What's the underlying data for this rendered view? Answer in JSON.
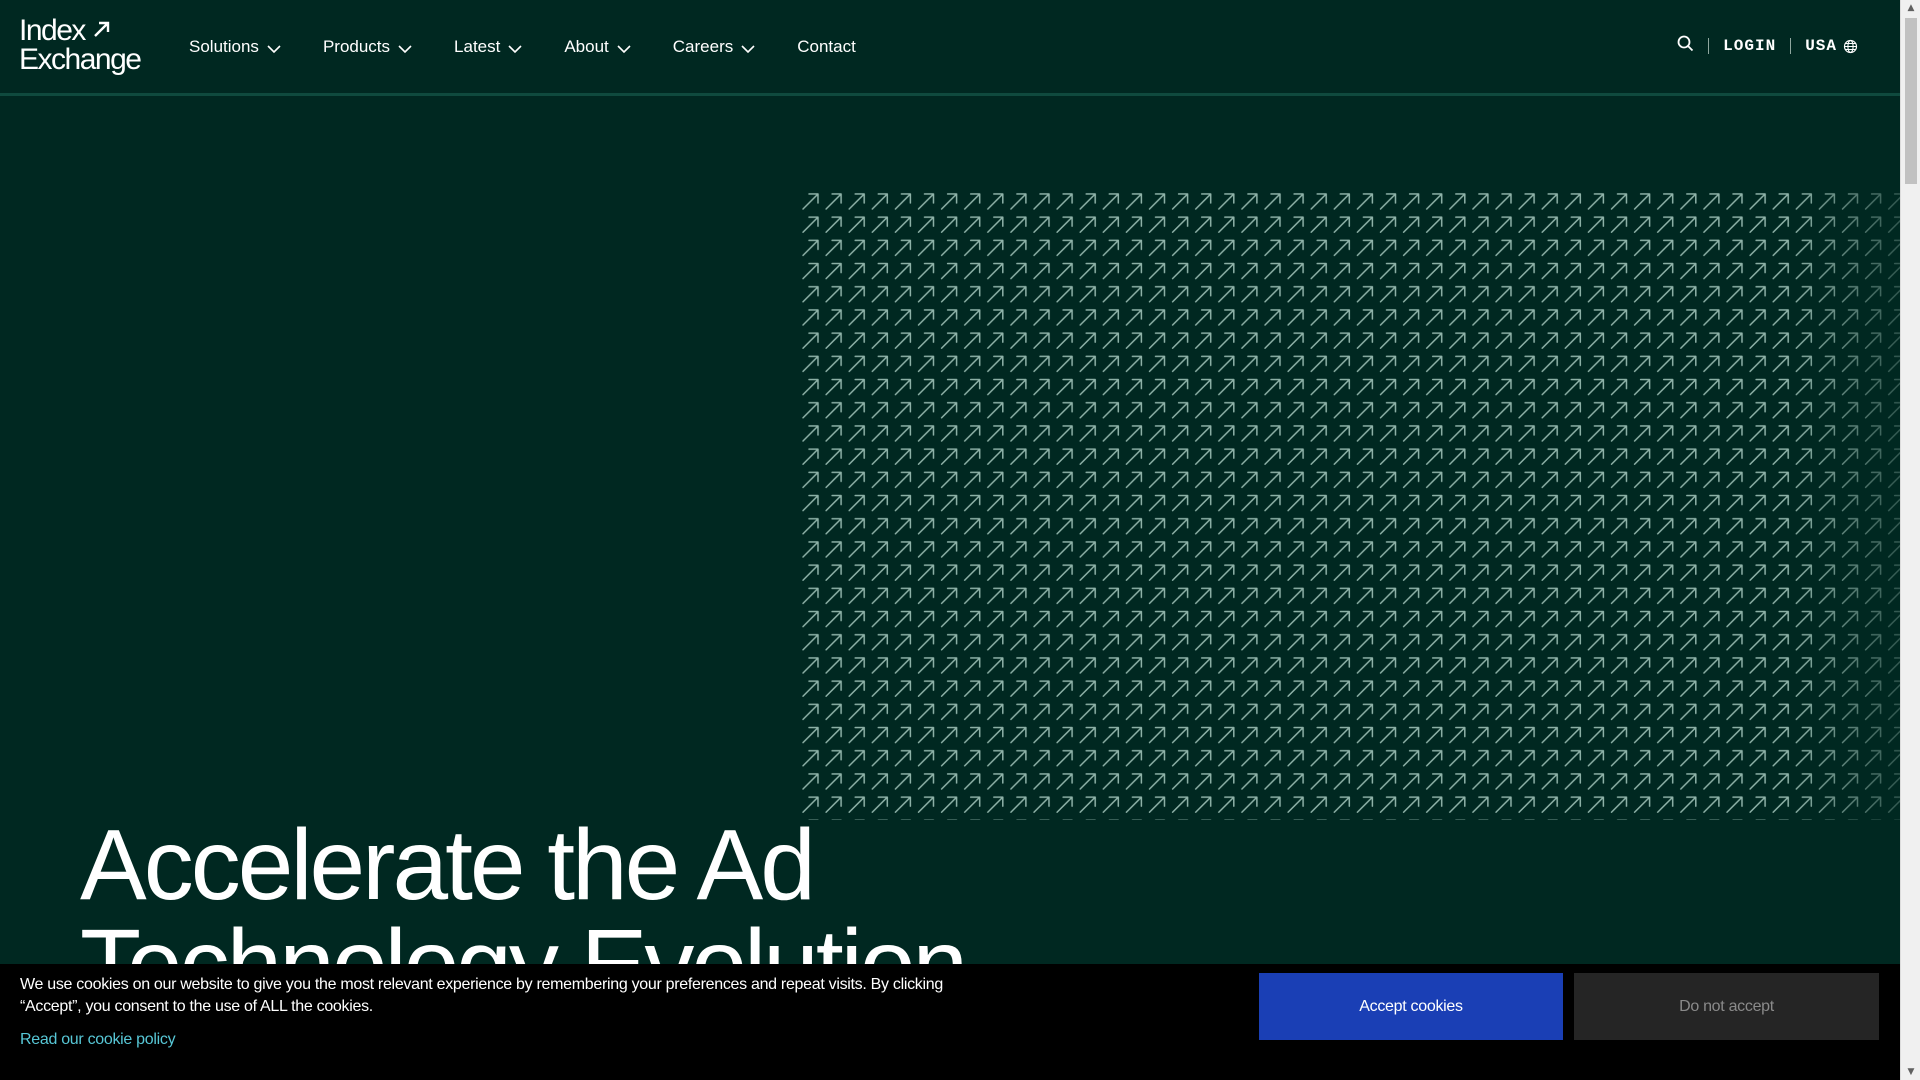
{
  "brand": {
    "logo_line1": "Index",
    "logo_line2": "Exchange"
  },
  "nav": {
    "items": [
      {
        "label": "Solutions",
        "has_dropdown": true
      },
      {
        "label": "Products",
        "has_dropdown": true
      },
      {
        "label": "Latest",
        "has_dropdown": true
      },
      {
        "label": "About",
        "has_dropdown": true
      },
      {
        "label": "Careers",
        "has_dropdown": true
      },
      {
        "label": "Contact",
        "has_dropdown": false
      }
    ]
  },
  "utility": {
    "search_icon": "search-icon",
    "login_label": "LOGIN",
    "region_label": "USA",
    "region_icon": "globe-icon"
  },
  "hero": {
    "title": "Accelerate the Ad Technology Evolution",
    "pattern_icon": "arrow-up-right-icon"
  },
  "cookie": {
    "message": "We use cookies on our website to give you the most relevant experience by remembering your preferences and repeat visits. By clicking “Accept”, you consent to the use of ALL the cookies.",
    "policy_link": "Read our cookie policy",
    "accept_label": "Accept cookies",
    "reject_label": "Do not accept"
  },
  "colors": {
    "background": "#002821",
    "pattern": "#8fb3a9",
    "accept_button": "#1a3fb5",
    "reject_button": "#252525",
    "link": "#57c7d6"
  }
}
